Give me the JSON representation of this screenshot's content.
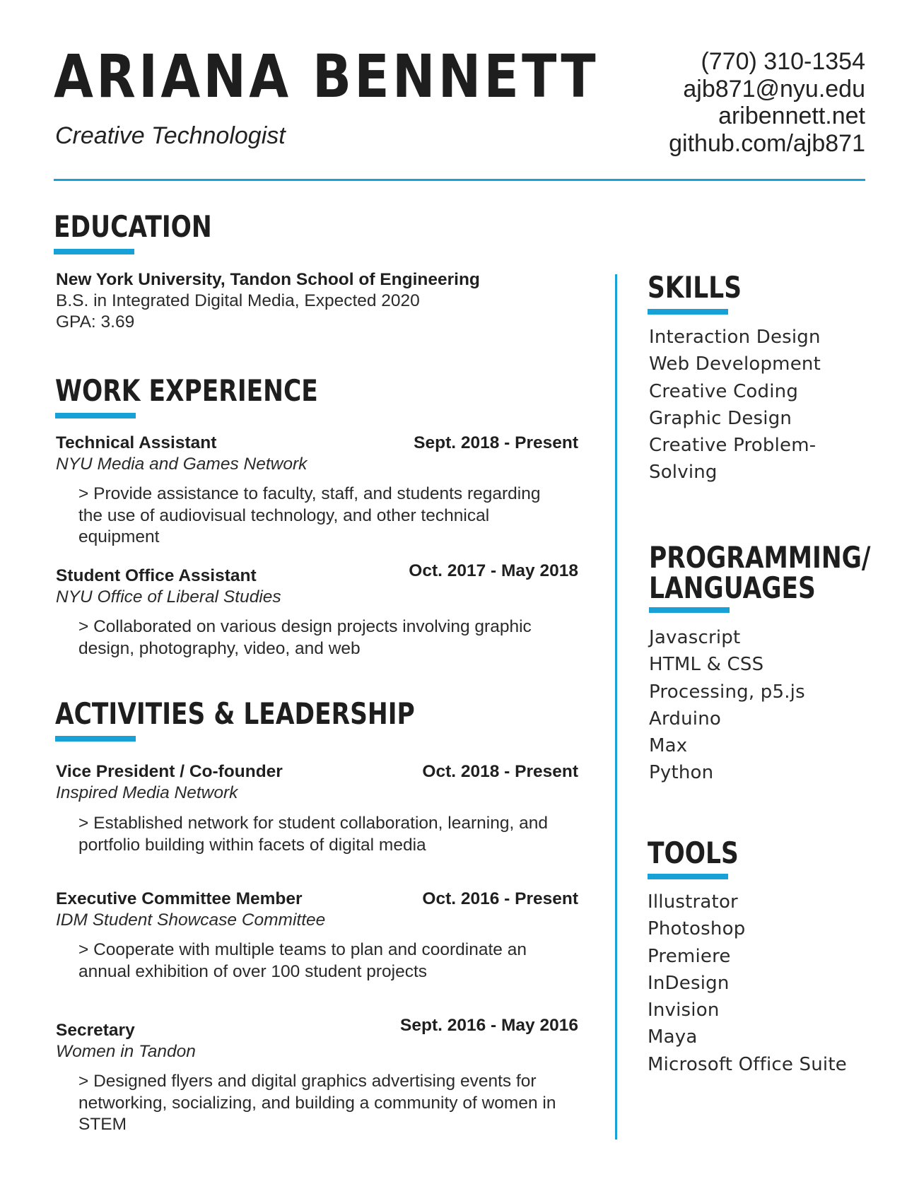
{
  "header": {
    "name": "ARIANA BENNETT",
    "title": "Creative Technologist",
    "contact": {
      "phone": "(770) 310-1354",
      "email": "ajb871@nyu.edu",
      "website": "aribennett.net",
      "github": "github.com/ajb871"
    }
  },
  "education": {
    "heading": "EDUCATION",
    "school": "New York University, Tandon School of Engineering",
    "degree": "B.S. in Integrated Digital Media, Expected 2020",
    "gpa": "GPA: 3.69"
  },
  "work": {
    "heading": "WORK EXPERIENCE",
    "items": [
      {
        "role": "Technical Assistant",
        "dates": "Sept. 2018 - Present",
        "org": "NYU Media and Games Network",
        "lines": [
          "> Provide assistance to faculty, staff, and students regarding",
          "the use of audiovisual technology, and other technical",
          "equipment"
        ]
      },
      {
        "role": "Student Office Assistant",
        "dates": "Oct. 2017 - May 2018",
        "org": "NYU Office of Liberal Studies",
        "lines": [
          "> Collaborated on various design projects involving graphic",
          "design, photography, video, and web"
        ]
      }
    ]
  },
  "activities": {
    "heading": "ACTIVITIES & LEADERSHIP",
    "items": [
      {
        "role": "Vice President / Co-founder",
        "dates": "Oct. 2018 - Present",
        "org": "Inspired Media Network",
        "lines": [
          "> Established network for student collaboration, learning, and",
          "portfolio building within facets of digital media"
        ]
      },
      {
        "role": "Executive Committee Member",
        "dates": "Oct. 2016 - Present",
        "org": "IDM Student Showcase Committee",
        "lines": [
          "> Cooperate with multiple teams to plan and coordinate an",
          "annual exhibition of over 100 student projects"
        ]
      },
      {
        "role": "Secretary",
        "dates": "Sept. 2016 - May 2016",
        "org": "Women in Tandon",
        "lines": [
          "> Designed flyers and digital graphics advertising events for",
          "networking, socializing, and building a community of women in",
          "STEM"
        ]
      }
    ]
  },
  "skills": {
    "heading": "SKILLS",
    "items": [
      "Interaction Design",
      "Web Development",
      "Creative Coding",
      "Graphic Design",
      "Creative Problem-",
      "Solving"
    ]
  },
  "programming": {
    "heading_line1": "PROGRAMMING/",
    "heading_line2": "LANGUAGES",
    "items": [
      "Javascript",
      "HTML & CSS",
      "Processing, p5.js",
      "Arduino",
      "Max",
      "Python"
    ]
  },
  "tools": {
    "heading": "TOOLS",
    "items": [
      "Illustrator",
      "Photoshop",
      "Premiere",
      "InDesign",
      "Invision",
      "Maya",
      "Microsoft Office Suite"
    ]
  },
  "colors": {
    "accent": "#18a1d6",
    "text": "#1f1f1f"
  }
}
